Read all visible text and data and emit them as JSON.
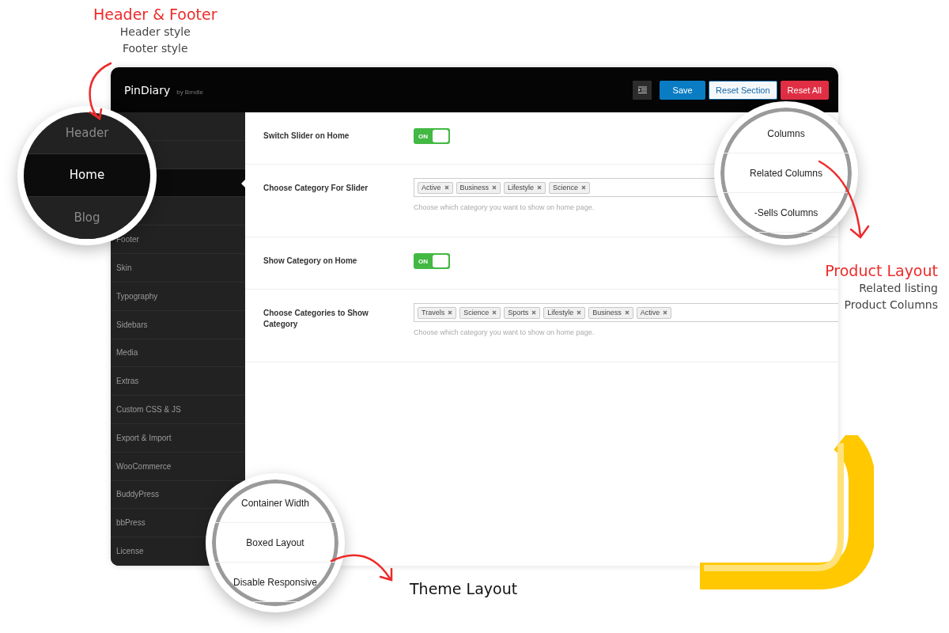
{
  "callouts": [
    {
      "title": "Header & Footer",
      "color": "#ee2a2a",
      "lines": [
        "Header style",
        "Footer style"
      ]
    },
    {
      "title": "Product Layout",
      "color": "#ee2a2a",
      "lines": [
        "Related listing",
        "Product Columns"
      ]
    },
    {
      "title": "Theme Layout",
      "color": "#111111"
    }
  ],
  "header": {
    "logo": "PinDiary",
    "byline": "by Brndle",
    "buttons": [
      {
        "label": "Save",
        "kind": "primary"
      },
      {
        "label": "Reset Section",
        "kind": "secondary"
      },
      {
        "label": "Reset All",
        "kind": "danger"
      }
    ]
  },
  "sidebar": {
    "items": [
      {
        "selected": false
      },
      {
        "selected": false
      },
      {
        "selected": true
      },
      {
        "selected": false
      },
      {
        "label": "Footer",
        "selected": false
      },
      {
        "label": "Skin",
        "selected": false
      },
      {
        "label": "Typography",
        "selected": false
      },
      {
        "label": "Sidebars",
        "selected": false
      },
      {
        "label": "Media",
        "selected": false
      },
      {
        "label": "Extras",
        "selected": false
      },
      {
        "label": "Custom CSS & JS",
        "selected": false
      },
      {
        "label": "Export & Import",
        "selected": false
      },
      {
        "label": "WooCommerce",
        "selected": false
      },
      {
        "label": "BuddyPress",
        "selected": false
      },
      {
        "label": "bbPress",
        "selected": false
      },
      {
        "label": "License",
        "selected": false
      }
    ]
  },
  "settings": [
    {
      "kind": "switch",
      "label": "Switch Slider on Home",
      "on": true,
      "switch_text": "ON"
    },
    {
      "kind": "tags",
      "label": "Choose Category For Slider",
      "tags": [
        "Active",
        "Business",
        "Lifestyle",
        "Science"
      ],
      "help": "Choose which category you want to show on home page."
    },
    {
      "kind": "switch",
      "label": "Show Category on Home",
      "on": true,
      "switch_text": "ON"
    },
    {
      "kind": "tags",
      "label": "Choose Categories to Show Category",
      "tags": [
        "Travels",
        "Science",
        "Sports",
        "Lifestyle",
        "Business",
        "Active"
      ],
      "help": "Choose which category you want to show on home page."
    }
  ],
  "magnifiers": [
    {
      "kind": "menu",
      "items": [
        {
          "label": "Header",
          "selected": false
        },
        {
          "label": "Home",
          "selected": true
        },
        {
          "label": "Blog",
          "selected": false
        }
      ]
    },
    {
      "kind": "list",
      "items": [
        {
          "label": "Columns"
        },
        {
          "label": "Related Columns"
        },
        {
          "label": "-Sells Columns"
        }
      ]
    },
    {
      "kind": "list",
      "items": [
        {
          "label": "Container Width"
        },
        {
          "label": "Boxed Layout"
        },
        {
          "label": "Disable Responsive"
        }
      ]
    }
  ]
}
